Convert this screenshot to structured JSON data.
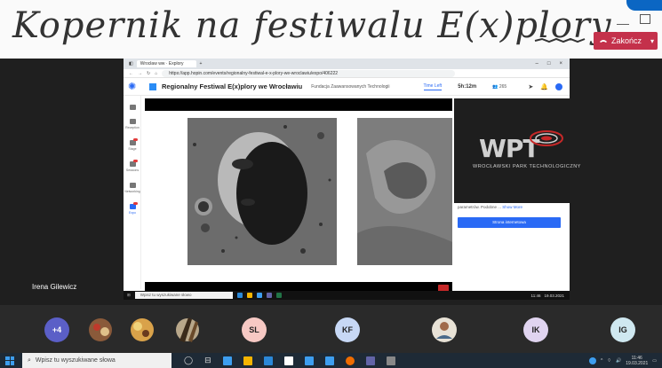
{
  "title": "Kopernik na festiwalu E(x)plory",
  "call_controls": {
    "end_label": "Zakończ"
  },
  "browser": {
    "tab_title": "Wrocław ww · Explory",
    "url": "https://app.hopin.com/events/regionalny-festiwal-e-x-plory-we-wroclawiu/expo/406222"
  },
  "hopin": {
    "event_title": "Regionalny Festiwal E(x)plory we Wrocławiu",
    "organizer": "Fundacja Zaawansowanych Technologii",
    "time_left_label": "Time Left",
    "timer": "5h:12m",
    "attendees": "265",
    "nav": [
      {
        "label": "Reception"
      },
      {
        "label": "Stage"
      },
      {
        "label": "Sessions"
      },
      {
        "label": "Networking"
      },
      {
        "label": "Expo"
      }
    ],
    "sponsor_logo": "WPT",
    "sponsor_subtitle": "WROCŁAWSKI PARK TECHNOLOGICZNY",
    "about_text": "parametrów. Podobne ...",
    "show_more": "Show More",
    "website_button": "Strona internetowa"
  },
  "inner_taskbar": {
    "search_placeholder": "Wpisz tu wyszukiwane słowo",
    "clock": "11:46",
    "date": "19.03.2021"
  },
  "speaker_name": "Irena Gilewicz",
  "participants": [
    {
      "initials": "+4",
      "color": "#5b5fc7"
    },
    {
      "initials": "SL",
      "color": "#f7c9c4"
    },
    {
      "initials": "KF",
      "color": "#c7d8f5"
    },
    {
      "initials": "IK",
      "color": "#e0d4f0"
    },
    {
      "initials": "IG",
      "color": "#cfe8f0"
    }
  ],
  "taskbar": {
    "search_placeholder": "Wpisz tu wyszukiwane słowa",
    "clock": "11:46",
    "date": "19.03.2021"
  }
}
